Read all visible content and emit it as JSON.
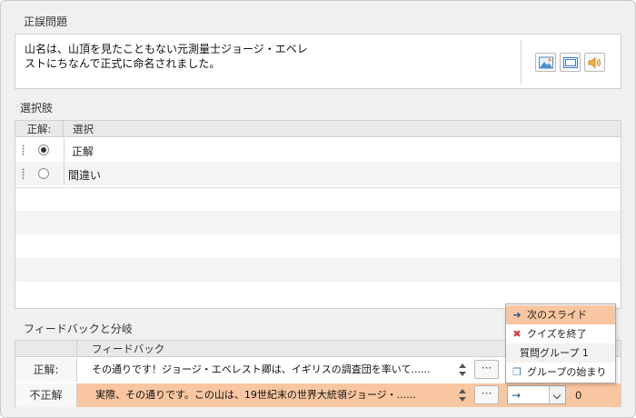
{
  "colors": {
    "accent_row": "#f9c6a2",
    "arrow_blue": "#1f4e8a",
    "close_red": "#d9363e"
  },
  "question": {
    "section_title": "正誤問題",
    "text_line1": "山名は、山頂を見たこともない元測量士ジョージ・エベレ",
    "text_line2": "ストにちなんで正式に命名されました。",
    "media_buttons": [
      "insert-picture-icon",
      "insert-video-icon",
      "insert-audio-icon"
    ]
  },
  "choices": {
    "section_title": "選択肢",
    "header_correct": "正解:",
    "header_choice": "選択",
    "items": [
      {
        "label": "正解",
        "selected": true
      },
      {
        "label": "間違い",
        "selected": false
      }
    ]
  },
  "feedback": {
    "section_title": "フィードバックと分岐",
    "header_feedback": "フィードバック",
    "rows": [
      {
        "label": "正解:",
        "text": "その通りです！ジョージ・エベレスト卿は、イギリスの調査団を率いて......",
        "more_label": "···",
        "branch_icon": "→",
        "slide_value": ""
      },
      {
        "label": "不正解",
        "text": "実際、その通りです。この山は、19世紀末の世界大統領ジョージ・......",
        "more_label": "···",
        "branch_icon": "→",
        "slide_value": "0"
      }
    ]
  },
  "branch_menu": {
    "items": [
      {
        "icon": "➔",
        "icon_name": "next-slide-arrow-icon",
        "label": "次のスライド",
        "selected": true
      },
      {
        "icon": "✖",
        "icon_name": "close-x-icon",
        "label": "クイズを終了",
        "selected": false
      },
      {
        "icon": "",
        "icon_name": "",
        "label": "質問グループ 1",
        "selected": false
      },
      {
        "icon": "❐",
        "icon_name": "group-start-icon",
        "label": "グループの始まり",
        "selected": false
      }
    ]
  }
}
